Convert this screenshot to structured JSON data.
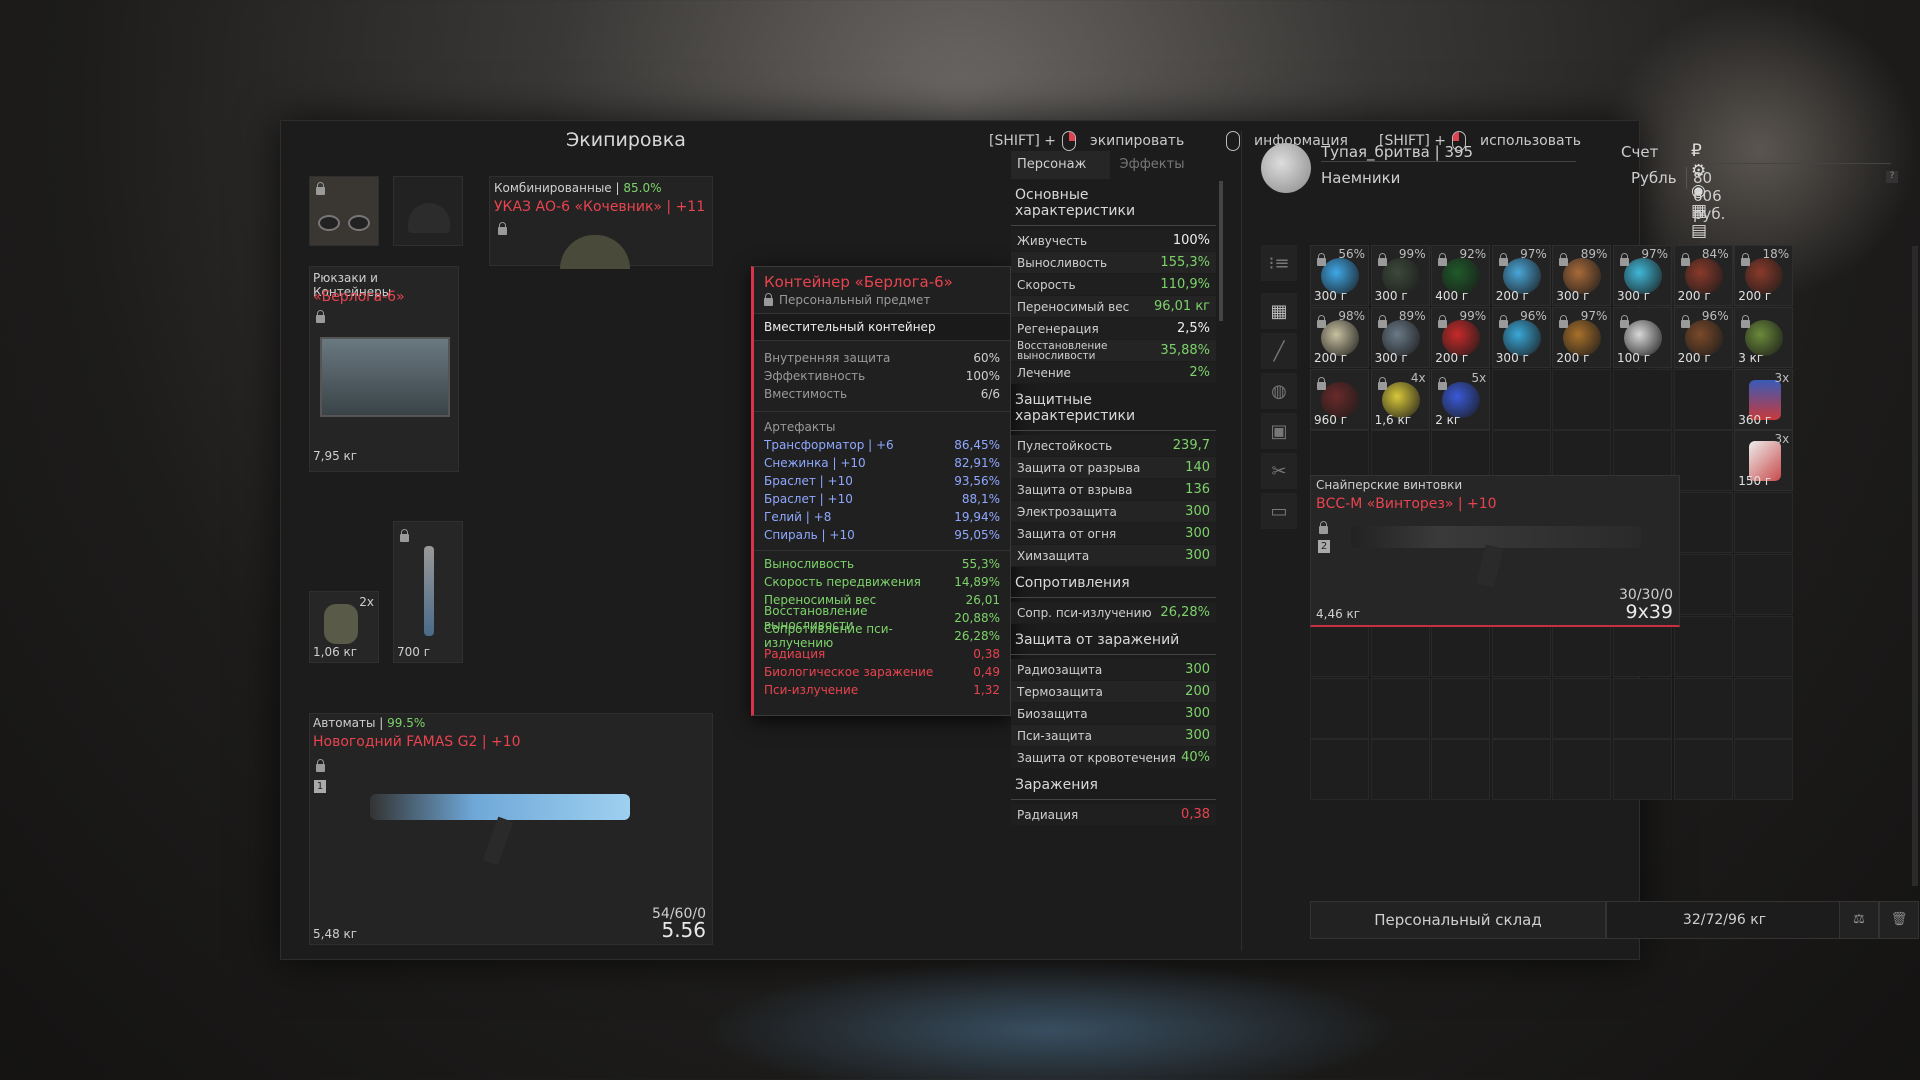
{
  "header": {
    "title": "Экипировка",
    "hint1_key": "[SHIFT] +",
    "hint1_label": "экипировать",
    "hint2_label": "информация",
    "hint3_key": "[SHIFT] +",
    "hint3_label": "использовать"
  },
  "armor": {
    "category": "Комбинированные",
    "condition": "85.0%",
    "name": "УКАЗ АО-6 «Кочевник» | +11"
  },
  "backpack": {
    "category": "Рюкзаки и Контейнеры",
    "name": "«Берлога-6»",
    "weight": "7,95 кг"
  },
  "grenade": {
    "count": "2x",
    "weight": "1,06 кг"
  },
  "knife": {
    "weight": "700 г"
  },
  "rifle": {
    "category": "Автоматы",
    "condition": "99.5%",
    "name": "Новогодний FAMAS G2 | +10",
    "slot": "1",
    "weight": "5,48 кг",
    "ammo": "54/60/0",
    "caliber": "5.56"
  },
  "tooltip": {
    "name": "Контейнер «Берлога-6»",
    "personal": "Персональный предмет",
    "type": "Вместительный контейнер",
    "stats": [
      {
        "k": "Внутренняя защита",
        "v": "60%"
      },
      {
        "k": "Эффективность",
        "v": "100%"
      },
      {
        "k": "Вместимость",
        "v": "6/6"
      }
    ],
    "artifacts_title": "Артефакты",
    "artifacts": [
      {
        "k": "Трансформатор | +6",
        "v": "86,45%"
      },
      {
        "k": "Снежинка | +10",
        "v": "82,91%"
      },
      {
        "k": "Браслет | +10",
        "v": "93,56%"
      },
      {
        "k": "Браслет | +10",
        "v": "88,1%"
      },
      {
        "k": "Гелий | +8",
        "v": "19,94%"
      },
      {
        "k": "Спираль | +10",
        "v": "95,05%"
      }
    ],
    "effects": [
      {
        "k": "Выносливость",
        "v": "55,3%",
        "c": "green"
      },
      {
        "k": "Скорость передвижения",
        "v": "14,89%",
        "c": "green"
      },
      {
        "k": "Переносимый вес",
        "v": "26,01",
        "c": "green"
      },
      {
        "k": "Восстановление выносливости",
        "v": "20,88%",
        "c": "green"
      },
      {
        "k": "Сопротивление пси-излучению",
        "v": "26,28%",
        "c": "green"
      },
      {
        "k": "Радиация",
        "v": "0,38",
        "c": "red"
      },
      {
        "k": "Биологическое заражение",
        "v": "0,49",
        "c": "red"
      },
      {
        "k": "Пси-излучение",
        "v": "1,32",
        "c": "red"
      }
    ]
  },
  "tabs": {
    "character": "Персонаж",
    "effects": "Эффекты"
  },
  "stats": {
    "basic_title": "Основные характеристики",
    "basic": [
      {
        "k": "Живучесть",
        "v": "100%",
        "c": "white"
      },
      {
        "k": "Выносливость",
        "v": "155,3%",
        "c": "green"
      },
      {
        "k": "Скорость",
        "v": "110,9%",
        "c": "green"
      },
      {
        "k": "Переносимый вес",
        "v": "96,01 кг",
        "c": "green"
      },
      {
        "k": "Регенерация",
        "v": "2,5%",
        "c": "white"
      },
      {
        "k": "Восстановление выносливости",
        "v": "35,88%",
        "c": "green"
      },
      {
        "k": "Лечение",
        "v": "2%",
        "c": "green"
      }
    ],
    "prot_title": "Защитные характеристики",
    "prot": [
      {
        "k": "Пулестойкость",
        "v": "239,7"
      },
      {
        "k": "Защита от разрыва",
        "v": "140"
      },
      {
        "k": "Защита от взрыва",
        "v": "136"
      },
      {
        "k": "Электрозащита",
        "v": "300"
      },
      {
        "k": "Защита от огня",
        "v": "300"
      },
      {
        "k": "Химзащита",
        "v": "300"
      }
    ],
    "res_title": "Сопротивления",
    "res": [
      {
        "k": "Сопр. пси-излучению",
        "v": "26,28%"
      }
    ],
    "inf_title": "Защита от заражений",
    "inf": [
      {
        "k": "Радиозащита",
        "v": "300"
      },
      {
        "k": "Термозащита",
        "v": "200"
      },
      {
        "k": "Биозащита",
        "v": "300"
      },
      {
        "k": "Пси-защита",
        "v": "300"
      },
      {
        "k": "Защита от кровотечения",
        "v": "40%"
      }
    ],
    "cont_title": "Заражения",
    "cont": [
      {
        "k": "Радиация",
        "v": "0,38"
      }
    ]
  },
  "player": {
    "name": "Тупая_бритва | 395",
    "faction": "Наемники",
    "account_label": "Счет",
    "currency": "Рубль",
    "balance": "80 606 руб."
  },
  "grid": {
    "items": [
      {
        "pct": "56%",
        "w": "300 г",
        "color": "#3fa8e8"
      },
      {
        "pct": "99%",
        "w": "300 г",
        "color": "#3c4a3a"
      },
      {
        "pct": "92%",
        "w": "400 г",
        "color": "#1f5a2a"
      },
      {
        "pct": "97%",
        "w": "200 г",
        "color": "#4aa6d8"
      },
      {
        "pct": "89%",
        "w": "300 г",
        "color": "#a86a3a"
      },
      {
        "pct": "97%",
        "w": "300 г",
        "color": "#40b8d8"
      },
      {
        "pct": "84%",
        "w": "200 г",
        "color": "#8a3a2a"
      },
      {
        "pct": "18%",
        "w": "200 г",
        "color": "#8a3a2a"
      },
      {
        "pct": "98%",
        "w": "200 г",
        "color": "#c8c0a0"
      },
      {
        "pct": "89%",
        "w": "300 г",
        "color": "#6a7a88"
      },
      {
        "pct": "99%",
        "w": "200 г",
        "color": "#c82a2a"
      },
      {
        "pct": "96%",
        "w": "300 г",
        "color": "#3aa8d8"
      },
      {
        "pct": "97%",
        "w": "200 г",
        "color": "#a8702a"
      },
      {
        "pct": "",
        "w": "100 г",
        "color": "#d8d8d8"
      },
      {
        "pct": "96%",
        "w": "200 г",
        "color": "#7a4a2a"
      },
      {
        "pct": "",
        "w": "3 кг",
        "color": "#6a8a3a"
      },
      {
        "pct": "",
        "w": "960 г",
        "color": "#6a2a2a"
      },
      {
        "pct": "4x",
        "w": "1,6 кг",
        "color": "#d8c83a"
      },
      {
        "pct": "5x",
        "w": "2 кг",
        "color": "#3a5ad8"
      }
    ],
    "side_items": [
      {
        "pct": "3x",
        "w": "360 г"
      },
      {
        "pct": "3x",
        "w": "150 г"
      }
    ]
  },
  "sniper": {
    "category": "Снайперские винтовки",
    "name": "ВСС-М «Винторез» | +10",
    "slot": "2",
    "weight": "4,46 кг",
    "ammo": "30/30/0",
    "caliber": "9x39"
  },
  "footer": {
    "storage": "Персональный склад",
    "weight": "32/72/96 кг"
  }
}
